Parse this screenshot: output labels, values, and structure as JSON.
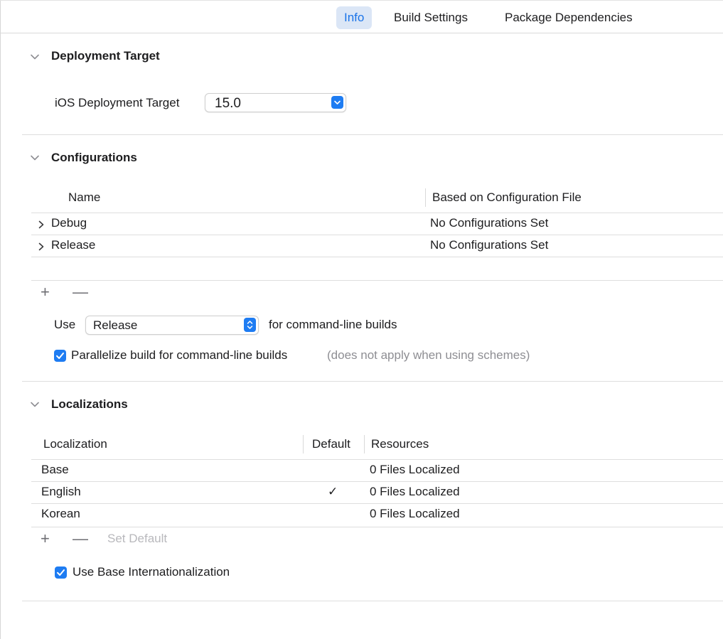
{
  "tabs": [
    {
      "label": "Info"
    },
    {
      "label": "Build Settings"
    },
    {
      "label": "Package Dependencies"
    }
  ],
  "deployment": {
    "title": "Deployment Target",
    "label": "iOS Deployment Target",
    "value": "15.0"
  },
  "configurations": {
    "title": "Configurations",
    "columns": [
      "Name",
      "Based on Configuration File"
    ],
    "rows": [
      {
        "name": "Debug",
        "file": "No Configurations Set"
      },
      {
        "name": "Release",
        "file": "No Configurations Set"
      }
    ],
    "add": "+",
    "remove": "—",
    "use_label": "Use",
    "use_value": "Release",
    "use_suffix": "for command-line builds",
    "parallelize_label": "Parallelize build for command-line builds",
    "parallelize_note": "(does not apply when using schemes)",
    "parallelize_checked": true
  },
  "localizations": {
    "title": "Localizations",
    "columns": [
      "Localization",
      "Default",
      "Resources"
    ],
    "rows": [
      {
        "name": "Base",
        "default": "",
        "resources": "0 Files Localized"
      },
      {
        "name": "English",
        "default": "✓",
        "resources": "0 Files Localized"
      },
      {
        "name": "Korean",
        "default": "",
        "resources": "0 Files Localized"
      }
    ],
    "add": "+",
    "remove": "—",
    "set_default": "Set Default",
    "base_intl_label": "Use Base Internationalization",
    "base_intl_checked": true
  },
  "colors": {
    "accent": "#1e7cf2",
    "tab_active_bg": "#dbe6f6",
    "tab_active_text": "#1a73e8"
  }
}
